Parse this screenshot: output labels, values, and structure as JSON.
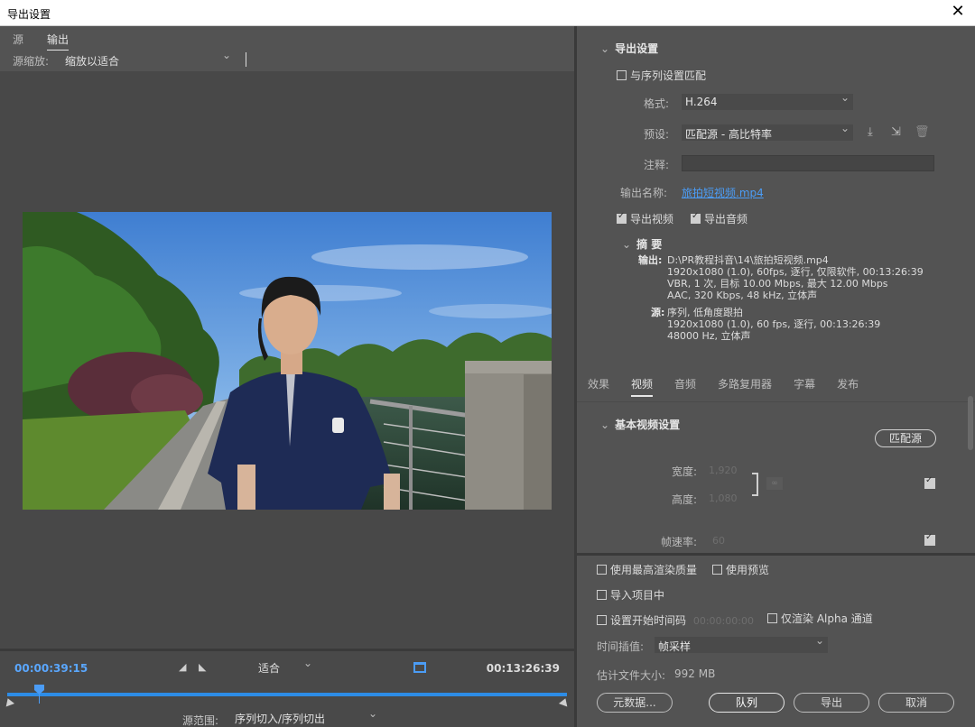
{
  "window": {
    "title": "导出设置",
    "close_glyph": "✕"
  },
  "left": {
    "tabs": [
      {
        "label": "源"
      },
      {
        "label": "输出"
      }
    ],
    "zoom_label": "源缩放:",
    "zoom_value": "缩放以适合",
    "timecode_current": "00:00:39:15",
    "timecode_end": "00:13:26:39",
    "fit_value": "适合",
    "range_label": "源范围:",
    "range_value": "序列切入/序列切出"
  },
  "export": {
    "section_title": "导出设置",
    "match_sequence": "与序列设置匹配",
    "format_label": "格式:",
    "format_value": "H.264",
    "preset_label": "预设:",
    "preset_value": "匹配源 - 高比特率",
    "comments_label": "注释:",
    "output_name_label": "输出名称:",
    "output_name_value": "旅拍短视频.mp4",
    "export_video": "导出视频",
    "export_audio": "导出音频",
    "summary_title": "摘 要",
    "summary_output_key": "输出:",
    "summary_output_lines": [
      "D:\\PR教程抖音\\14\\旅拍短视频.mp4",
      "1920x1080 (1.0), 60fps, 逐行, 仅限软件, 00:13:26:39",
      "VBR, 1 次, 目标 10.00 Mbps, 最大 12.00 Mbps",
      "AAC, 320 Kbps, 48 kHz, 立体声"
    ],
    "summary_source_key": "源:",
    "summary_source_lines": [
      "序列, 低角度跟拍",
      "1920x1080 (1.0), 60 fps, 逐行, 00:13:26:39",
      "48000 Hz, 立体声"
    ]
  },
  "tabs_right": [
    {
      "label": "效果"
    },
    {
      "label": "视频"
    },
    {
      "label": "音频"
    },
    {
      "label": "多路复用器"
    },
    {
      "label": "字幕"
    },
    {
      "label": "发布"
    }
  ],
  "video": {
    "section_title": "基本视频设置",
    "match_source_btn": "匹配源",
    "width_label": "宽度:",
    "width_value": "1,920",
    "height_label": "高度:",
    "height_value": "1,080",
    "framerate_label": "帧速率:",
    "framerate_value": "60"
  },
  "bottom": {
    "max_render_quality": "使用最高渲染质量",
    "use_previews": "使用预览",
    "import_into_project": "导入项目中",
    "set_start_timecode": "设置开始时间码",
    "start_timecode_value": "00:00:00:00",
    "render_alpha_only": "仅渲染 Alpha 通道",
    "time_interp_label": "时间插值:",
    "time_interp_value": "帧采样",
    "est_size_label": "估计文件大小:",
    "est_size_value": "992 MB",
    "metadata_btn": "元数据...",
    "queue_btn": "队列",
    "export_btn": "导出",
    "cancel_btn": "取消"
  }
}
